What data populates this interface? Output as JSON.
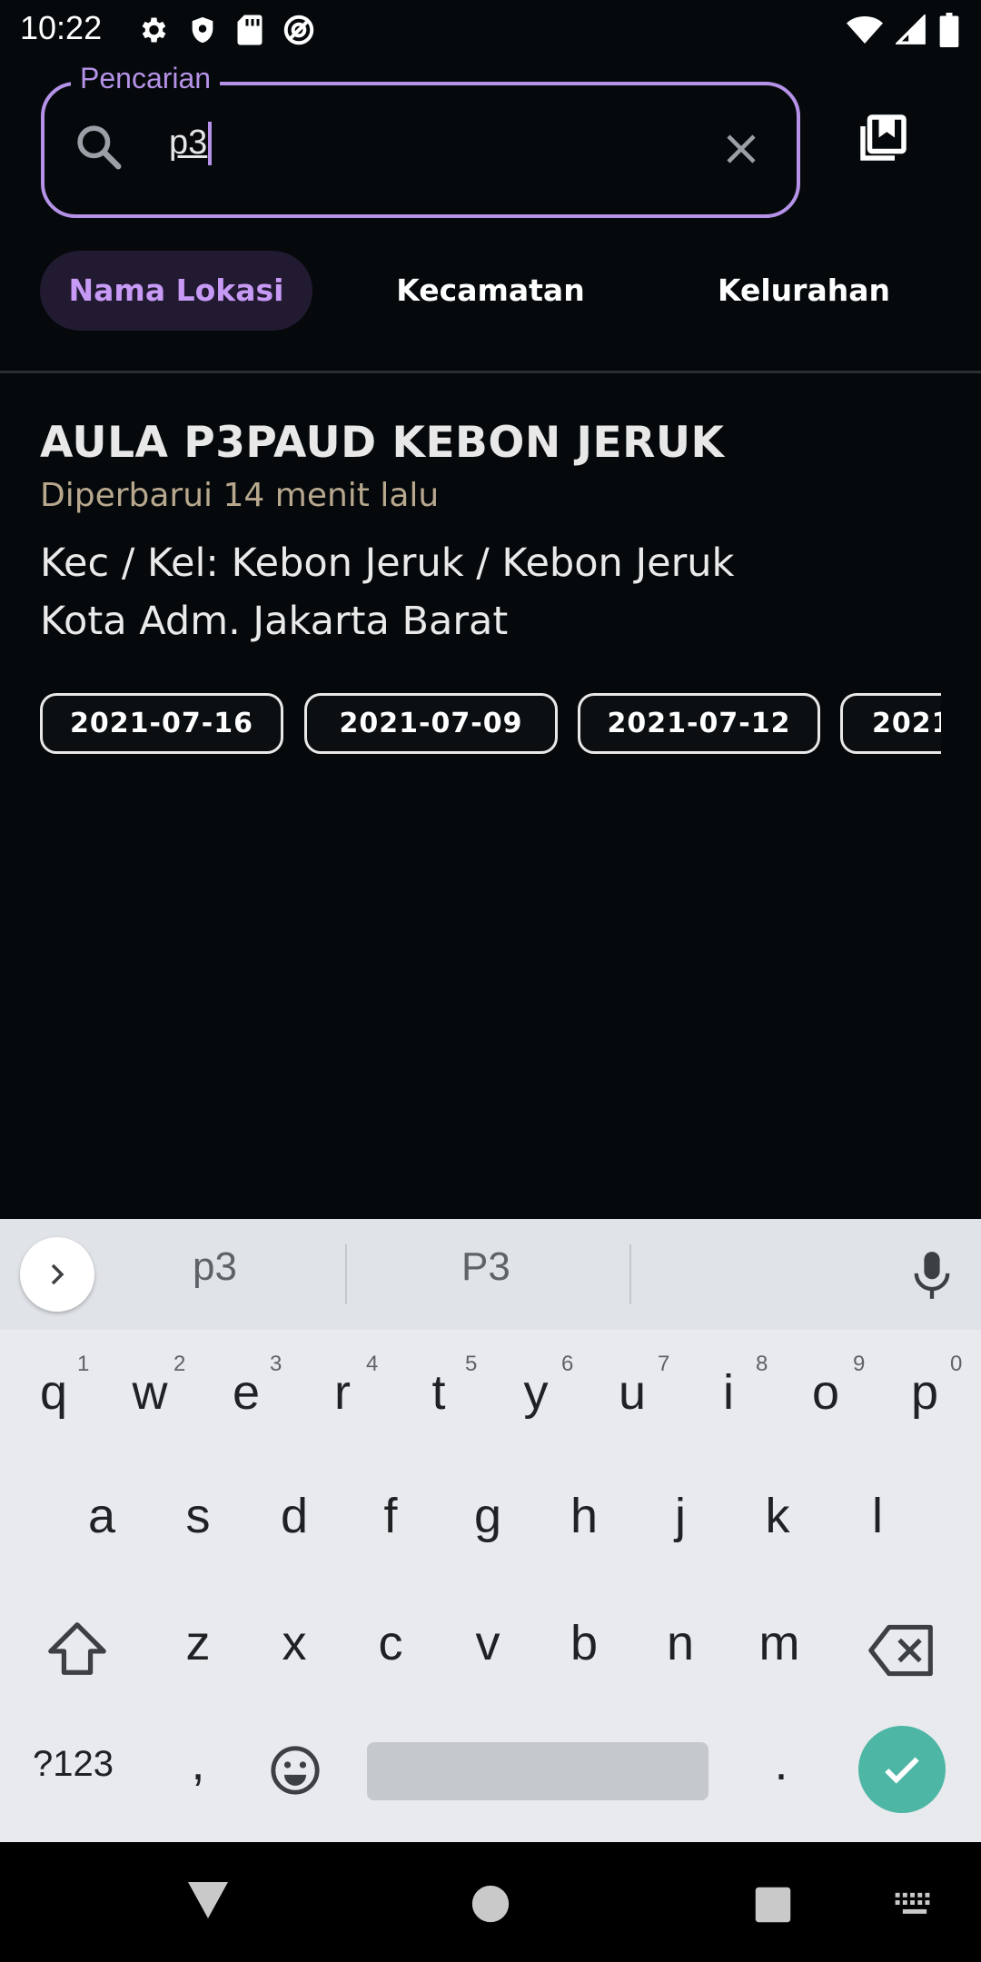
{
  "status": {
    "time": "10:22"
  },
  "search": {
    "legend": "Pencarian",
    "value": "p3"
  },
  "tabs": [
    {
      "label": "Nama Lokasi",
      "active": true
    },
    {
      "label": "Kecamatan",
      "active": false
    },
    {
      "label": "Kelurahan",
      "active": false
    }
  ],
  "result": {
    "title": "AULA P3PAUD KEBON JERUK",
    "updated": "Diperbarui 14 menit lalu",
    "kec_kel": "Kec / Kel: Kebon Jeruk / Kebon Jeruk",
    "city": "Kota Adm. Jakarta Barat",
    "dates": [
      "2021-07-16",
      "2021-07-09",
      "2021-07-12",
      "2021"
    ]
  },
  "keyboard": {
    "suggestions": [
      "p3",
      "P3"
    ],
    "row1": [
      "q",
      "w",
      "e",
      "r",
      "t",
      "y",
      "u",
      "i",
      "o",
      "p"
    ],
    "row1_hints": [
      "1",
      "2",
      "3",
      "4",
      "5",
      "6",
      "7",
      "8",
      "9",
      "0"
    ],
    "row2": [
      "a",
      "s",
      "d",
      "f",
      "g",
      "h",
      "j",
      "k",
      "l"
    ],
    "row3": [
      "z",
      "x",
      "c",
      "v",
      "b",
      "n",
      "m"
    ],
    "symbols_label": "?123",
    "comma": ",",
    "period": "."
  },
  "colors": {
    "accent": "#b592e8",
    "tab_active_bg": "#221a31",
    "tab_active_text": "#c79af5",
    "updated_text": "#b8a88e",
    "enter_key": "#4db6a5",
    "background": "#05090b"
  }
}
